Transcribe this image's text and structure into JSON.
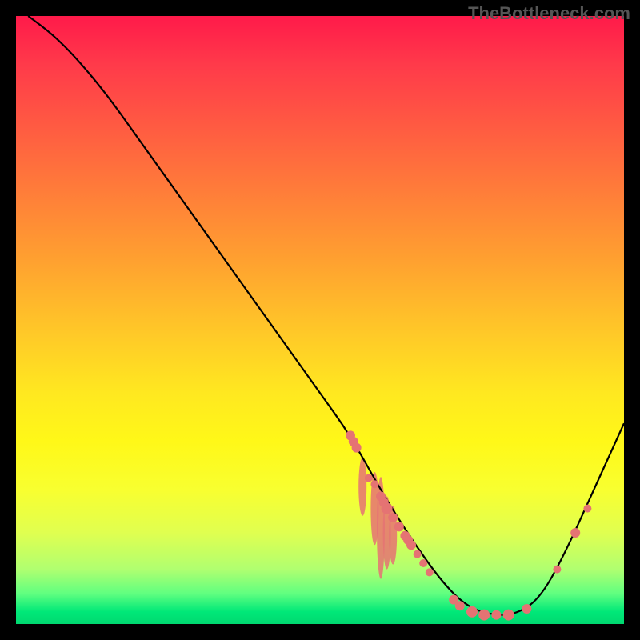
{
  "attribution": "TheBottleneck.com",
  "chart_data": {
    "type": "line",
    "title": "",
    "xlabel": "",
    "ylabel": "",
    "xlim": [
      0,
      100
    ],
    "ylim": [
      0,
      100
    ],
    "curve": [
      {
        "x": 2,
        "y": 100
      },
      {
        "x": 6,
        "y": 97
      },
      {
        "x": 10,
        "y": 93
      },
      {
        "x": 15,
        "y": 87
      },
      {
        "x": 20,
        "y": 80
      },
      {
        "x": 30,
        "y": 66
      },
      {
        "x": 40,
        "y": 52
      },
      {
        "x": 50,
        "y": 38
      },
      {
        "x": 55,
        "y": 31
      },
      {
        "x": 60,
        "y": 22
      },
      {
        "x": 65,
        "y": 14
      },
      {
        "x": 70,
        "y": 7
      },
      {
        "x": 74,
        "y": 3
      },
      {
        "x": 78,
        "y": 1.5
      },
      {
        "x": 82,
        "y": 1.5
      },
      {
        "x": 86,
        "y": 4
      },
      {
        "x": 90,
        "y": 11
      },
      {
        "x": 95,
        "y": 22
      },
      {
        "x": 100,
        "y": 33
      }
    ],
    "markers": [
      {
        "x": 55,
        "y": 31,
        "r": 6
      },
      {
        "x": 55.5,
        "y": 30,
        "r": 6
      },
      {
        "x": 56,
        "y": 29,
        "r": 6
      },
      {
        "x": 58,
        "y": 24,
        "r": 5
      },
      {
        "x": 59,
        "y": 23,
        "r": 5
      },
      {
        "x": 60,
        "y": 21,
        "r": 6
      },
      {
        "x": 60.5,
        "y": 20,
        "r": 6
      },
      {
        "x": 61,
        "y": 19,
        "r": 7
      },
      {
        "x": 62,
        "y": 17.5,
        "r": 6
      },
      {
        "x": 63,
        "y": 16,
        "r": 6
      },
      {
        "x": 64,
        "y": 14.5,
        "r": 6
      },
      {
        "x": 64.5,
        "y": 13.8,
        "r": 6
      },
      {
        "x": 65,
        "y": 13,
        "r": 6
      },
      {
        "x": 66,
        "y": 11.5,
        "r": 5
      },
      {
        "x": 67,
        "y": 10,
        "r": 5
      },
      {
        "x": 68,
        "y": 8.5,
        "r": 5
      },
      {
        "x": 72,
        "y": 4,
        "r": 6
      },
      {
        "x": 73,
        "y": 3,
        "r": 6
      },
      {
        "x": 75,
        "y": 2,
        "r": 7
      },
      {
        "x": 77,
        "y": 1.5,
        "r": 7
      },
      {
        "x": 79,
        "y": 1.5,
        "r": 6
      },
      {
        "x": 81,
        "y": 1.5,
        "r": 7
      },
      {
        "x": 84,
        "y": 2.5,
        "r": 6
      },
      {
        "x": 89,
        "y": 9,
        "r": 5
      },
      {
        "x": 92,
        "y": 15,
        "r": 6
      },
      {
        "x": 94,
        "y": 19,
        "r": 5
      }
    ],
    "marker_color": "#e57373",
    "curve_color": "#000000",
    "xstretches": [
      {
        "x": 57,
        "y": 25,
        "h": 8
      },
      {
        "x": 59,
        "y": 22,
        "h": 10
      },
      {
        "x": 60,
        "y": 20,
        "h": 14
      },
      {
        "x": 61,
        "y": 18,
        "h": 10
      },
      {
        "x": 62,
        "y": 17,
        "h": 8
      }
    ]
  }
}
